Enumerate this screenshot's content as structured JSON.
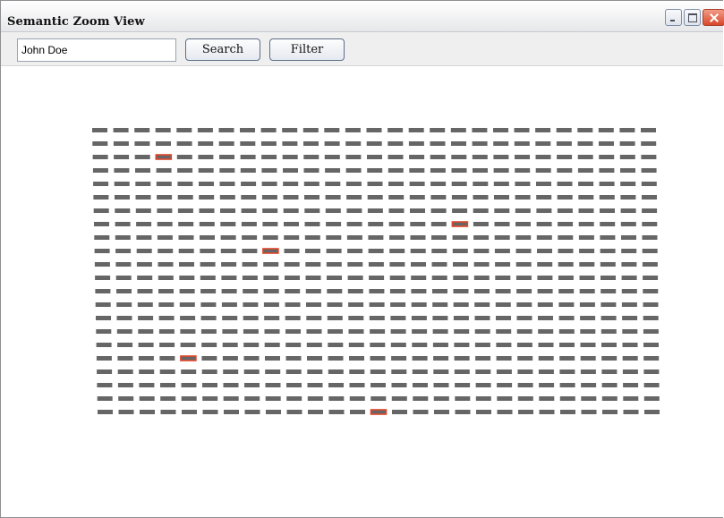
{
  "window": {
    "title": "Semantic Zoom View"
  },
  "toolbar": {
    "search_value": "John Doe",
    "search_label": "Search",
    "filter_label": "Filter"
  },
  "grid": {
    "rows": 22,
    "columns": 27,
    "item_color": "#666666",
    "highlight_color": "#e0452a",
    "highlighted_items": [
      {
        "row": 3,
        "col": 4
      },
      {
        "row": 8,
        "col": 18
      },
      {
        "row": 10,
        "col": 9
      },
      {
        "row": 18,
        "col": 5
      },
      {
        "row": 22,
        "col": 14
      }
    ]
  }
}
